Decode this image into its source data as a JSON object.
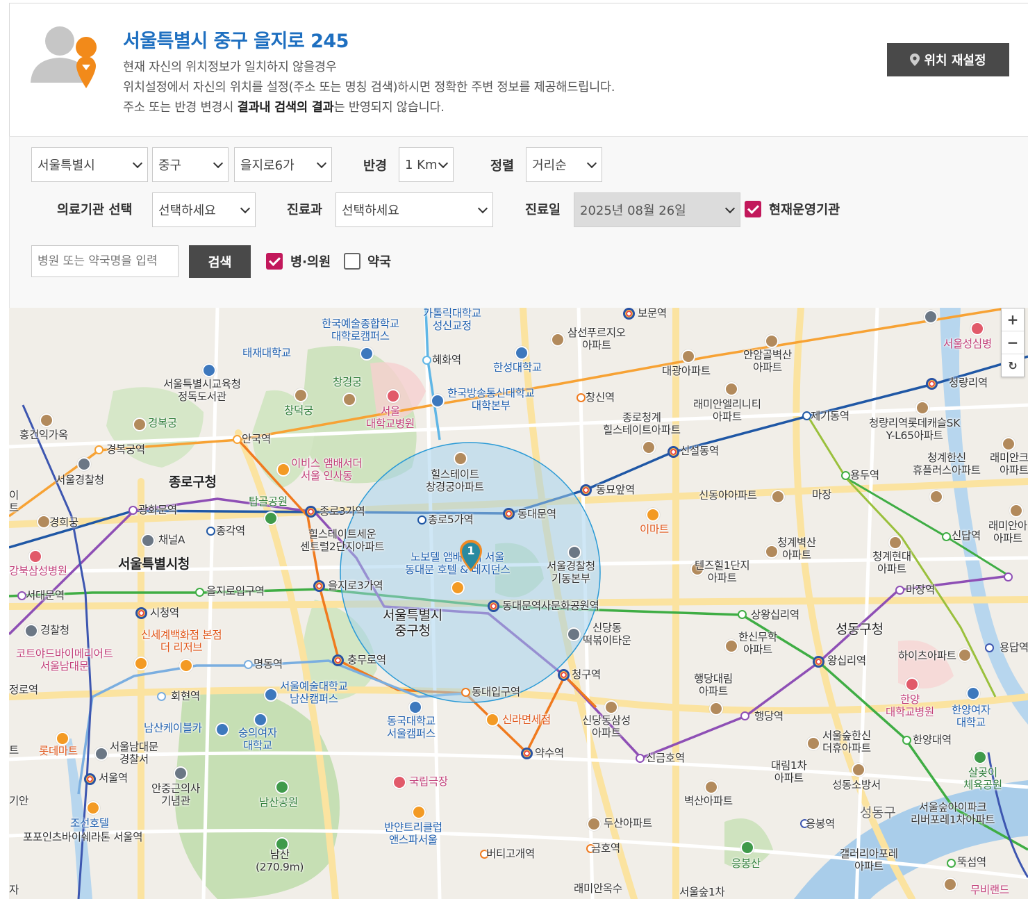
{
  "location": {
    "address": "서울특별시 중구 을지로 245",
    "notice_1": "현재 자신의 위치정보가 일치하지 않을경우",
    "notice_2": "위치설정에서 자신의 위치를 설정(주소 또는 명칭 검색)하시면 정확한 주변 정보를 제공해드립니다.",
    "notice_3_pre": "주소 또는 반경 변경시 ",
    "notice_3_bold": "결과내 검색의 결과",
    "notice_3_post": "는 반영되지 않습니다.",
    "reset_button": "위치 재설정"
  },
  "filters": {
    "city": "서울특별시",
    "district": "중구",
    "dong": "을지로6가",
    "radius_label": "반경",
    "radius": "1 Km",
    "sort_label": "정렬",
    "sort": "거리순",
    "facility_label": "의료기관 선택",
    "facility": "선택하세요",
    "department_label": "진료과",
    "department": "선택하세요",
    "date_label": "진료일",
    "date": "2025년 08월 26일",
    "operating_label": "현재운영기관",
    "operating_checked": true,
    "search_placeholder": "병원 또는 약국명을 입력",
    "search_button": "검색",
    "hospital_label": "병·의원",
    "hospital_checked": true,
    "pharmacy_label": "약국",
    "pharmacy_checked": false
  },
  "map": {
    "zoom_in": "+",
    "zoom_out": "−",
    "refresh": "↻",
    "marker_count": "1",
    "colors": {
      "radius_fill": "#9fd0ee",
      "radius_stroke": "#2a9ad6",
      "marker": "#2a8aa0"
    },
    "labels": {
      "gatholic": "가톨릭대학교\n성신교정",
      "bomun": "보문역",
      "samsun": "삼선푸르지오\n아파트",
      "anam": "안암골벽산\n아파트",
      "daegwang": "대광아파트",
      "hyehwa": "혜화역",
      "hansung": "한성대학교",
      "changsin": "창신역",
      "knua": "한국예술종합학교\n대학로캠퍼스",
      "taejae": "태재대학교",
      "library": "서울특별시교육청\n정독도서관",
      "changgyeong": "창경궁",
      "changdeok": "창덕궁",
      "snuh": "서울\n대학교병원",
      "knou": "한국방송통신대학교\n대학본부",
      "cheongnyang": "청량리역",
      "jegi": "제기동역",
      "raemian": "래미안엘리니티\n아파트",
      "jongro_hill": "종로청계\n힐스테이트아파트",
      "cheongnyang_sk": "청량리역롯데캐슬SK\nY-L65아파트",
      "seoul_sungsim": "서울성심병",
      "gyeongbok": "경복궁",
      "hongun": "홍건익가옥",
      "gyeongbokgung_st": "경복궁역",
      "anguk": "안국역",
      "ibis": "이비스 앰배서더\n서울 인사동",
      "hill_changgyeong": "힐스테이트\n창경궁아파트",
      "sinseoldong": "신설동역",
      "cheongnyang_hanshin": "청계한신\n휴플러스아파트",
      "raemian2": "래미안크레\n아파트",
      "police_hq": "서울경찰청",
      "jongno_office": "종로구청",
      "gwanghwamun": "광화문역",
      "tapgol": "탑골공원",
      "jongno3": "종로3가역",
      "jongno5": "종로5가역",
      "dongdaemun": "동대문역",
      "dongmyo": "동묘앞역",
      "yongdu": "용두역",
      "sinseol_apt": "신동아아파트",
      "majang": "마장",
      "gyeonghui": "경희궁",
      "jonggak": "종각역",
      "channel_a": "채널A",
      "hillstate_seun": "힐스테이트세운\n센트럴2단지아파트",
      "emart": "이마트",
      "cheonggye_byeoksan": "청계벽산\n아파트",
      "sindap": "신답역",
      "raemian3": "래미안아\n아파트",
      "city_hall": "서울특별시청",
      "kangbuk": "강북삼성병원",
      "novotel": "노보텔 앰배서더 서울\n동대문 호텔 & 레지던스",
      "police_gidong": "서울경찰청\n기동본부",
      "tenzhill": "텐즈힐1단지\n아파트",
      "cheonggye_hyundai": "청계현대\n아파트",
      "majang_st": "마장역",
      "seodaemun": "서대문역",
      "euljiro_ent": "을지로입구역",
      "euljiro3": "을지로3가역",
      "ddp": "동대문역사문화공원역",
      "city_hall_st": "시청역",
      "junggu": "서울특별시\n중구청",
      "sindang_tteok": "신당동\n떡볶이타운",
      "sangwangsimni": "상왕십리역",
      "seongdong": "성동구청",
      "police_st": "경찰청",
      "shinsegae": "신세계백화점 본점\n더 리저브",
      "courtyard": "코트야드바이메리어트\n서울남대문",
      "chungmuro": "충무로역",
      "cheonggu": "청구역",
      "hanshin_mr": "한신무학\n아파트",
      "wangsimni": "왕십리역",
      "hicheu": "하이츠아파트",
      "yongdap": "용답역",
      "myeongdong": "명동역",
      "hoehyeon": "회현역",
      "sia": "서울예술대학교\n남산캠퍼스",
      "dongdae_ent": "동대입구역",
      "haengdang": "행당대림\n아파트",
      "hanyang_hosp": "한양\n대학교병원",
      "hanyang_w": "한양여자\n대학교",
      "seodaemun2": "정로역",
      "namsan_cable": "남산케이블카",
      "sookmyung": "숭의여자\n대학교",
      "dongguk": "동국대학교\n서울캠퍼스",
      "shilla": "신라면세점",
      "sindang_samsung": "신당동삼성\n아파트",
      "haengdang_st": "행당역",
      "hanyang_st": "한양대역",
      "lotte_mart": "롯데마트",
      "namdaemun_police": "서울남대문\n경찰서",
      "seoul_st": "서울역",
      "yaksu": "약수역",
      "singeumho": "신금호역",
      "seoul_forest_hanshin": "서울숲한신\n더휴아파트",
      "ahn_memorial": "안중근의사\n기념관",
      "national_theater": "국립극장",
      "daerim1": "대림1차\n아파트",
      "seongdong_fire": "성동소방서",
      "salgoji": "살곶이\n체육공원",
      "namsan_park": "남산공원",
      "byeoksan": "벽산아파트",
      "four_points": "포포인츠바이쉐라톤 서울역",
      "joseon": "조선호텔",
      "banyan": "반얀트리클럽\n앤스파서울",
      "dusan": "두산아파트",
      "eungbong": "응봉역",
      "seongdong_gu": "성동구",
      "seoul_forest_ip": "서울숲아이파크\n리버포레1차아파트",
      "namsan": "남산\n(270.9m)",
      "beotigogae": "버티고개역",
      "geumho": "금호역",
      "eungbongsan": "응봉산",
      "gallery": "갤러리아포레\n아파트",
      "ttukseom": "뚝섬역",
      "raemian_oksu": "래미안옥수",
      "seoul_forest1": "서울숲1차",
      "mubirand": "무비랜드",
      "edge_i": "이\n트",
      "edge_ja": "자",
      "edge_giyan": "기안",
      "edge_teu": "트"
    }
  }
}
